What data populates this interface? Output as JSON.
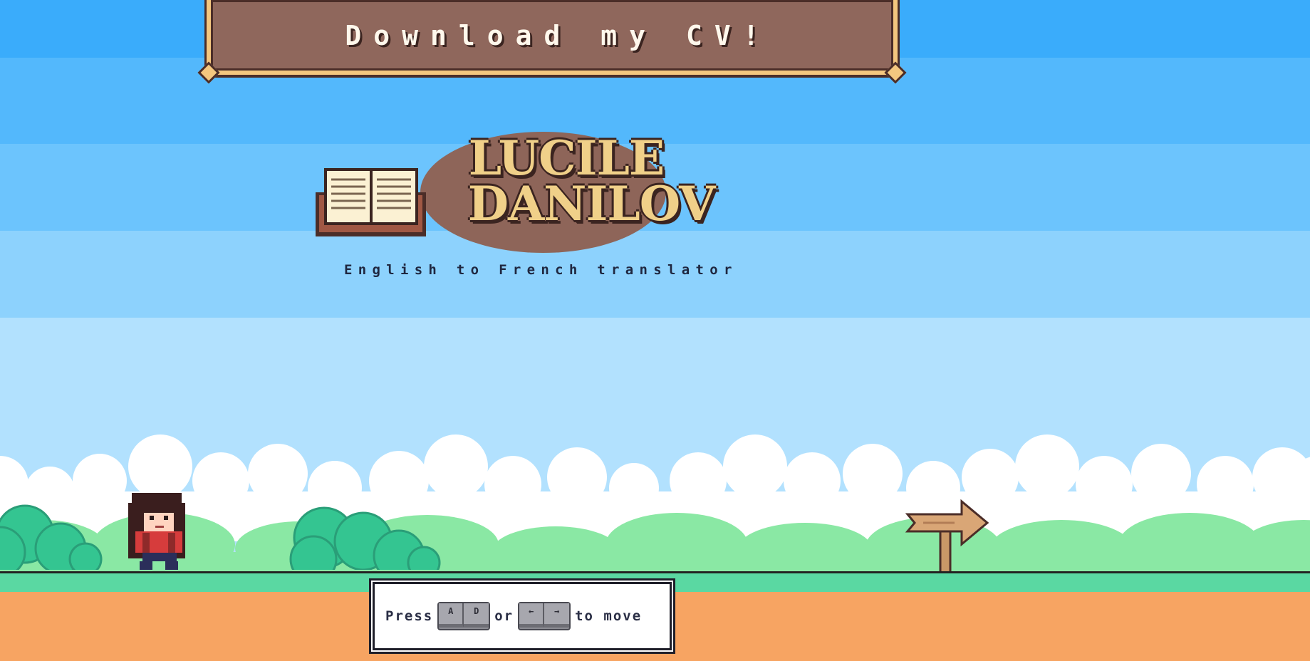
{
  "cv_button": {
    "label": "Download my CV!"
  },
  "logo": {
    "line1": "LUCILE",
    "line2": "DANILOV",
    "subtitle": "English to French translator"
  },
  "controls_hint": {
    "press": "Press",
    "keys_letters": [
      "A",
      "D"
    ],
    "or": "or",
    "keys_arrows": [
      "←",
      "→"
    ],
    "suffix": "to move"
  },
  "colors": {
    "banner": "#8f675c",
    "banner_border": "#f4c77f",
    "grass": "#5ad8a2",
    "dirt": "#f7a462",
    "bush": "#34c591",
    "cloud": "#ffffff"
  },
  "icons": {
    "logo": "open-book-icon",
    "signpost": "arrow-signpost-icon",
    "player": "player-character"
  }
}
